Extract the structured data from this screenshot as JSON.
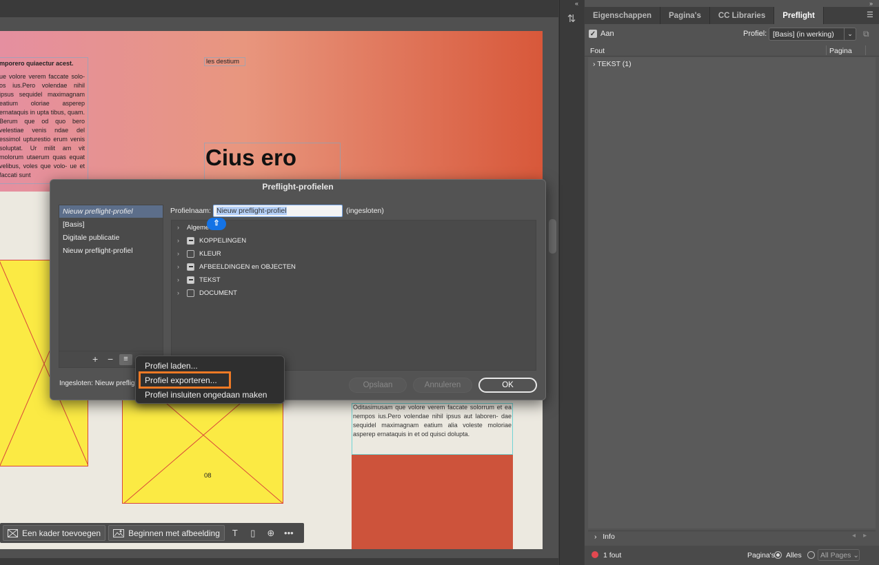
{
  "canvas": {
    "left_text_bold": "mporero quiaectur acest.",
    "left_text_body": "ue volore verem faccate solo- os ius.Pero volendae nihil ipsus sequidel maximagnam eatium oloriae asperep ernataquis in upta tibus, quam. Berum que od quo bero velestiae venis ndae del essimol upturestio erum venis soluptat. Ur milit am vit molorum utaerum quas equat velibus, voles que volo- ue et faccati sunt",
    "top_frame_text": "les destium",
    "headline": "Cius ero",
    "page_number": "08",
    "right_text": "Oditasimusam que volore verem faccate solorrum et ea nempos ius.Pero volendae nihil ipsus aut laboren- dae sequidel maximagnam eatium alia voleste moloriae asperep ernataquis in et od quisci dolupta.",
    "colors": {
      "gradient_start": "#e58fa0",
      "gradient_end": "#d8583a",
      "placeholder_yellow": "#fbea44",
      "red_block": "#cd533b"
    }
  },
  "context_bar": {
    "add_frame": "Een kader toevoegen",
    "start_image": "Beginnen met afbeelding",
    "icons": [
      "frame-icon",
      "image-icon",
      "text-icon",
      "document-icon",
      "page-add-icon",
      "more-icon"
    ]
  },
  "panel": {
    "tabs": [
      "Eigenschappen",
      "Pagina's",
      "CC Libraries",
      "Preflight"
    ],
    "active_tab": "Preflight",
    "on_label": "Aan",
    "profile_label": "Profiel:",
    "profile_value": "[Basis] (in werking)",
    "col_error": "Fout",
    "col_page": "Pagina",
    "error_group": "TEKST (1)",
    "info_label": "Info",
    "error_count": "1 fout",
    "pages_label": "Pagina's:",
    "all_label": "Alles",
    "all_pages": "All Pages"
  },
  "dialog": {
    "title": "Preflight-profielen",
    "profiles": [
      "Nieuw preflight-profiel",
      "[Basis]",
      "Digitale publicatie",
      "Nieuw preflight-profiel"
    ],
    "profile_name_label": "Profielnaam:",
    "profile_name_value": "Nieuw preflight-profiel",
    "embedded_label": "(ingesloten)",
    "tree": [
      "Algemeen",
      "KOPPELINGEN",
      "KLEUR",
      "AFBEELDINGEN en OBJECTEN",
      "TEKST",
      "DOCUMENT"
    ],
    "embedded_status": "Ingesloten: Nieuw preflig",
    "save_button": "Opslaan",
    "cancel_button": "Annuleren",
    "ok_button": "OK",
    "plus": "+",
    "minus": "−",
    "menu": "≡"
  },
  "popup_menu": {
    "items": [
      "Profiel laden...",
      "Profiel exporteren...",
      "Profiel insluiten ongedaan maken"
    ],
    "highlighted": "Profiel exporteren...",
    "highlight_color": "#f07a25"
  }
}
